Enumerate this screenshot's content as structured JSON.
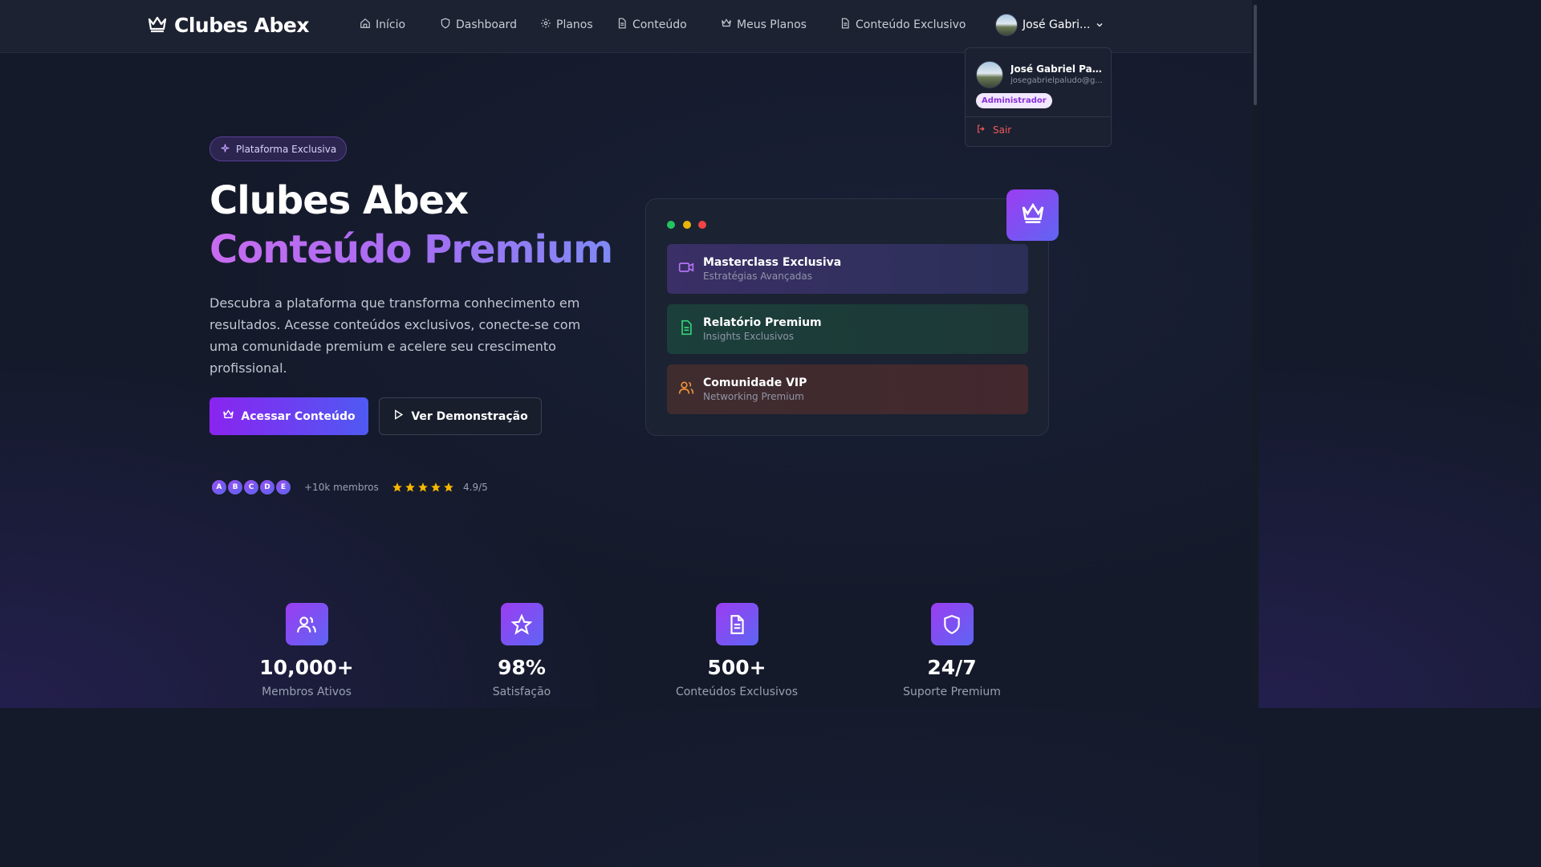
{
  "brand": {
    "name": "Clubes Abex"
  },
  "nav": {
    "items": [
      {
        "label": "Início",
        "icon": "home-icon"
      },
      {
        "label": "Dashboard",
        "icon": "shield-icon"
      },
      {
        "label": "Planos",
        "icon": "gear-icon"
      },
      {
        "label": "Conteúdo",
        "icon": "document-icon"
      },
      {
        "label": "Meus Planos",
        "icon": "crown-icon"
      },
      {
        "label": "Conteúdo Exclusivo",
        "icon": "document-icon"
      }
    ]
  },
  "user": {
    "short_name": "José Gabri...",
    "full_name": "José Gabriel Palu...",
    "email": "josegabrielpaludo@g...",
    "role": "Administrador",
    "logout_label": "Sair"
  },
  "hero": {
    "badge": "Plataforma Exclusiva",
    "title_line1": "Clubes Abex",
    "title_line2": "Conteúdo Premium",
    "description": "Descubra a plataforma que transforma conhecimento em resultados. Acesse conteúdos exclusivos, conecte-se com uma comunidade premium e acelere seu crescimento profissional.",
    "primary_button": "Acessar Conteúdo",
    "secondary_button": "Ver Demonstração",
    "avatars": [
      "A",
      "B",
      "C",
      "D",
      "E"
    ],
    "members": "+10k membros",
    "rating": "4.9/5",
    "stars": 5
  },
  "preview": {
    "cards": [
      {
        "title": "Masterclass Exclusiva",
        "subtitle": "Estratégias Avançadas",
        "icon": "video-icon",
        "color": "#b374f5"
      },
      {
        "title": "Relatório Premium",
        "subtitle": "Insights Exclusivos",
        "icon": "document-icon",
        "color": "#34d27a"
      },
      {
        "title": "Comunidade VIP",
        "subtitle": "Networking Premium",
        "icon": "users-icon",
        "color": "#f0923a"
      }
    ],
    "window_dots": [
      "#22c55e",
      "#eab308",
      "#ef4444"
    ]
  },
  "stats": [
    {
      "value": "10,000+",
      "label": "Membros Ativos",
      "icon": "users-icon"
    },
    {
      "value": "98%",
      "label": "Satisfação",
      "icon": "star-icon"
    },
    {
      "value": "500+",
      "label": "Conteúdos Exclusivos",
      "icon": "document-icon"
    },
    {
      "value": "24/7",
      "label": "Suporte Premium",
      "icon": "shield-icon"
    }
  ],
  "colors": {
    "accent_purple": "#8a24f0",
    "accent_blue": "#4f5af2",
    "star": "#f5b800",
    "logout": "#f05a5a"
  }
}
